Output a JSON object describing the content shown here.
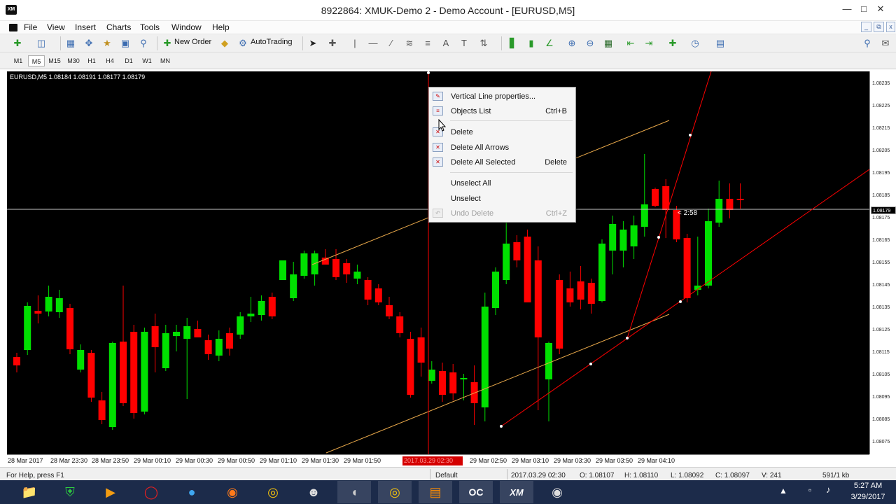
{
  "window": {
    "title": "8922864: XMUK-Demo 2 - Demo Account - [EURUSD,M5]",
    "logo": "XM"
  },
  "menu": [
    "File",
    "View",
    "Insert",
    "Charts",
    "Tools",
    "Window",
    "Help"
  ],
  "toolbar": {
    "new_order": "New Order",
    "autotrading": "AutoTrading"
  },
  "timeframes": [
    "M1",
    "M5",
    "M15",
    "M30",
    "H1",
    "H4",
    "D1",
    "W1",
    "MN"
  ],
  "active_timeframe": "M5",
  "chart": {
    "symbol_info": "EURUSD,M5  1.08184 1.08191 1.08177 1.08179",
    "timer": "< 2:58",
    "current_price": "1.08179",
    "price_ticks": [
      "1.08235",
      "1.08225",
      "1.08215",
      "1.08205",
      "1.08195",
      "1.08185",
      "1.08175",
      "1.08165",
      "1.08155",
      "1.08145",
      "1.08135",
      "1.08125",
      "1.08115",
      "1.08105",
      "1.08095",
      "1.08085",
      "1.08075"
    ],
    "time_ticks": [
      "28 Mar 2017",
      "28 Mar 23:30",
      "28 Mar 23:50",
      "29 Mar 00:10",
      "29 Mar 00:30",
      "29 Mar 00:50",
      "29 Mar 01:10",
      "29 Mar 01:30",
      "29 Mar 01:50",
      "29 Mar 02:50",
      "29 Mar 03:10",
      "29 Mar 03:30",
      "29 Mar 03:50",
      "29 Mar 04:10"
    ],
    "vline_label": "2017.03.29 02:30",
    "colors": {
      "bull": "#00e000",
      "bear": "#ff0000",
      "channel": "#e8a84a",
      "trendline": "#ff0000",
      "background": "#000000"
    }
  },
  "context_menu": {
    "items": [
      {
        "label": "Vertical Line properties...",
        "shortcut": "",
        "icon": "properties-icon",
        "enabled": true
      },
      {
        "label": "Objects List",
        "shortcut": "Ctrl+B",
        "icon": "objects-list-icon",
        "enabled": true
      },
      {
        "label": "Delete",
        "shortcut": "",
        "icon": "delete-icon",
        "enabled": true
      },
      {
        "label": "Delete All Arrows",
        "shortcut": "",
        "icon": "delete-arrows-icon",
        "enabled": true
      },
      {
        "label": "Delete All Selected",
        "shortcut": "Delete",
        "icon": "delete-selected-icon",
        "enabled": true
      },
      {
        "label": "Unselect All",
        "shortcut": "",
        "icon": "",
        "enabled": true
      },
      {
        "label": "Unselect",
        "shortcut": "",
        "icon": "",
        "enabled": true
      },
      {
        "label": "Undo Delete",
        "shortcut": "Ctrl+Z",
        "icon": "undo-icon",
        "enabled": false
      }
    ]
  },
  "status": {
    "help": "For Help, press F1",
    "profile": "Default",
    "time": "2017.03.29 02:30",
    "open": "O: 1.08107",
    "high": "H: 1.08110",
    "low": "L: 1.08092",
    "close": "C: 1.08097",
    "volume": "V: 241",
    "traffic": "591/1 kb"
  },
  "taskbar": {
    "time": "5:27 AM",
    "date": "3/29/2017"
  }
}
